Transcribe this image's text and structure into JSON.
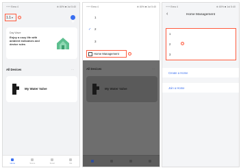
{
  "status": {
    "carrier": "+++ Brea 4",
    "right": "⊕ 80% ■ 1st 5:40"
  },
  "panel1": {
    "home_selector": "1.1",
    "callout_1": "1",
    "welcome": {
      "small": "Day Wave",
      "title": "Enjoy a cozy life with ambient indicators and device rules"
    },
    "section_label": "All Devices",
    "more": "···",
    "device_name": "My Water Valve",
    "tabs": [
      "Home",
      "Scene",
      "Smart",
      "Me"
    ]
  },
  "panel2": {
    "homes": [
      "1",
      "2",
      "3"
    ],
    "checked_index": 1,
    "management_label": "Home Management",
    "callout_2": "2",
    "section_label": "All Devices",
    "more": "···",
    "device_name": "My Water Valve"
  },
  "panel3": {
    "title": "Home Management",
    "back": "‹",
    "homes": [
      "1",
      "2",
      "3"
    ],
    "callout_3": "3",
    "create_home": "Create a Home",
    "join_home": "Join a Home"
  },
  "colors": {
    "accent": "#3a6ff0",
    "callout": "#ff5a3c"
  }
}
